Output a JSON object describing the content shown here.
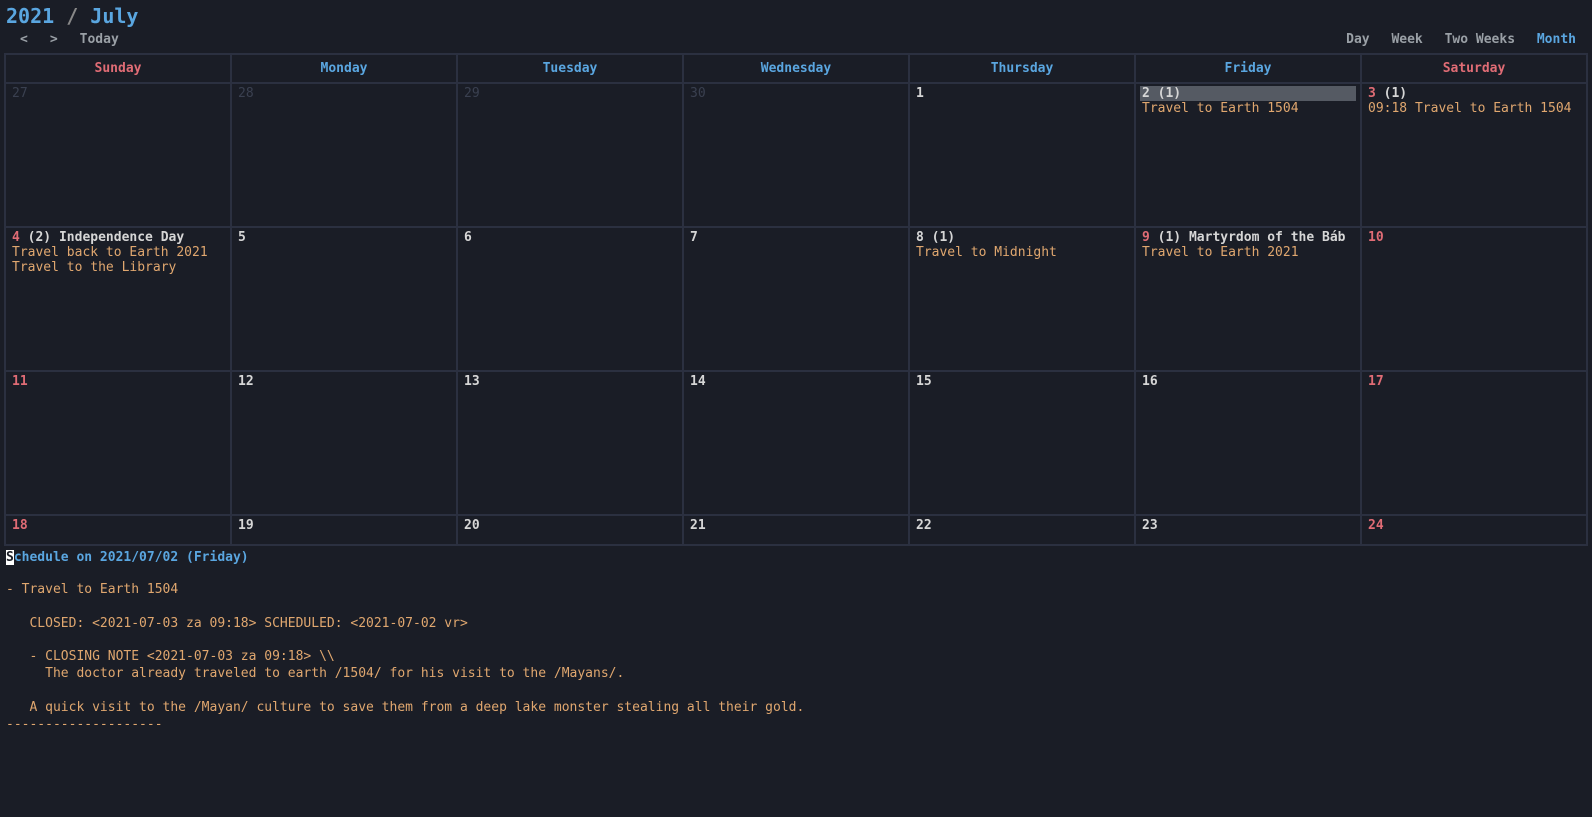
{
  "header": {
    "year": "2021",
    "sep": " / ",
    "month": "July",
    "prev": "<",
    "next": ">",
    "today": "Today",
    "views": {
      "day": "Day",
      "week": "Week",
      "two_weeks": "Two Weeks",
      "month": "Month"
    }
  },
  "weekday_headers": [
    "Sunday",
    "Monday",
    "Tuesday",
    "Wednesday",
    "Thursday",
    "Friday",
    "Saturday"
  ],
  "cells": {
    "r0c0": {
      "num": "27"
    },
    "r0c1": {
      "num": "28"
    },
    "r0c2": {
      "num": "29"
    },
    "r0c3": {
      "num": "30"
    },
    "r0c4": {
      "num": "1"
    },
    "r0c5": {
      "num": "2",
      "count": "(1)",
      "ev1": "Travel to Earth 1504"
    },
    "r0c6": {
      "num": "3",
      "count": "(1)",
      "ev1": "09:18 Travel to Earth 1504"
    },
    "r1c0": {
      "num": "4",
      "count": "(2)",
      "holiday": "Independence Day",
      "ev1": "Travel back to Earth 2021",
      "ev2": "Travel to the Library"
    },
    "r1c1": {
      "num": "5"
    },
    "r1c2": {
      "num": "6"
    },
    "r1c3": {
      "num": "7"
    },
    "r1c4": {
      "num": "8",
      "count": "(1)",
      "ev1": "Travel to Midnight"
    },
    "r1c5": {
      "num": "9",
      "count": "(1)",
      "holiday": "Martyrdom of the Báb",
      "ev1": "Travel to Earth 2021"
    },
    "r1c6": {
      "num": "10"
    },
    "r2c0": {
      "num": "11"
    },
    "r2c1": {
      "num": "12"
    },
    "r2c2": {
      "num": "13"
    },
    "r2c3": {
      "num": "14"
    },
    "r2c4": {
      "num": "15"
    },
    "r2c5": {
      "num": "16"
    },
    "r2c6": {
      "num": "17"
    },
    "r3c0": {
      "num": "18"
    },
    "r3c1": {
      "num": "19"
    },
    "r3c2": {
      "num": "20"
    },
    "r3c3": {
      "num": "21"
    },
    "r3c4": {
      "num": "22"
    },
    "r3c5": {
      "num": "23"
    },
    "r3c6": {
      "num": "24"
    }
  },
  "schedule": {
    "title_first_char": "S",
    "title_rest": "chedule on 2021/07/02 (Friday)",
    "body": "\n- Travel to Earth 1504\n\n   CLOSED: <2021-07-03 za 09:18> SCHEDULED: <2021-07-02 vr>\n\n   - CLOSING NOTE <2021-07-03 za 09:18> \\\\\n     The doctor already traveled to earth /1504/ for his visit to the /Mayans/.\n\n   A quick visit to the /Mayan/ culture to save them from a deep lake monster stealing all their gold.\n",
    "rule": "--------------------"
  }
}
